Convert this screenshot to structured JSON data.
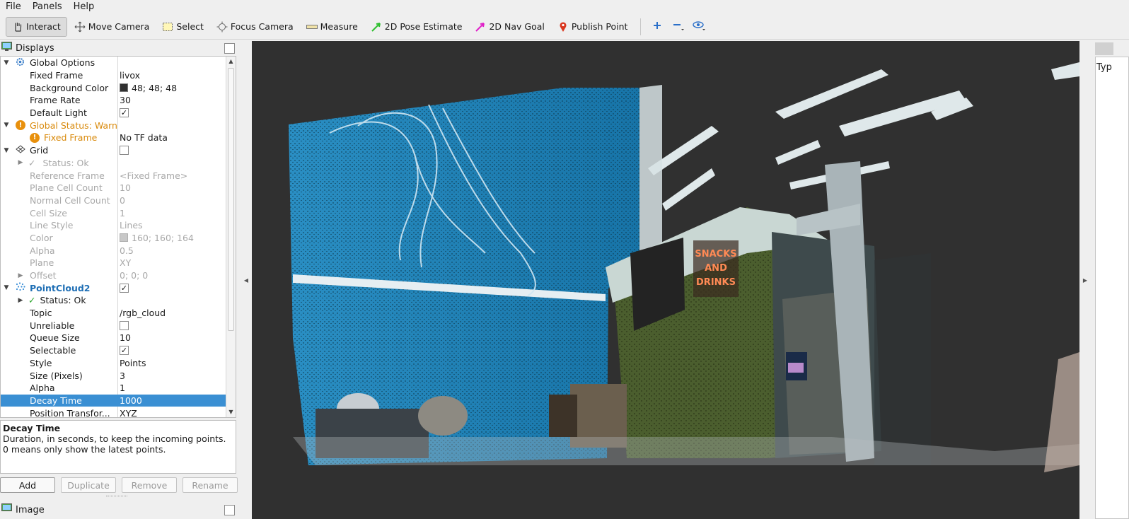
{
  "menu": [
    "File",
    "Panels",
    "Help"
  ],
  "toolbar": {
    "tools": [
      {
        "label": "Interact",
        "icon": "hand-icon"
      },
      {
        "label": "Move Camera",
        "icon": "move-camera-icon"
      },
      {
        "label": "Select",
        "icon": "select-icon"
      },
      {
        "label": "Focus Camera",
        "icon": "focus-camera-icon"
      },
      {
        "label": "Measure",
        "icon": "ruler-icon"
      },
      {
        "label": "2D Pose Estimate",
        "icon": "green-arrow-icon"
      },
      {
        "label": "2D Nav Goal",
        "icon": "magenta-arrow-icon"
      },
      {
        "label": "Publish Point",
        "icon": "map-pin-icon"
      }
    ]
  },
  "displays": {
    "title": "Displays",
    "global_options": "Global Options",
    "fixed_frame_label": "Fixed Frame",
    "fixed_frame_value": "livox",
    "background_color_label": "Background Color",
    "background_color_value": "48; 48; 48",
    "frame_rate_label": "Frame Rate",
    "frame_rate_value": "30",
    "default_light_label": "Default Light",
    "global_status": "Global Status: Warn",
    "fixed_frame_warn_label": "Fixed Frame",
    "fixed_frame_warn_value": "No TF data",
    "grid": "Grid",
    "status_ok": "Status: Ok",
    "reference_frame_label": "Reference Frame",
    "reference_frame_value": "<Fixed Frame>",
    "plane_cell_count_label": "Plane Cell Count",
    "plane_cell_count_value": "10",
    "normal_cell_count_label": "Normal Cell Count",
    "normal_cell_count_value": "0",
    "cell_size_label": "Cell Size",
    "cell_size_value": "1",
    "line_style_label": "Line Style",
    "line_style_value": "Lines",
    "color_label": "Color",
    "color_value": "160; 160; 164",
    "alpha_label": "Alpha",
    "alpha_value": "0.5",
    "plane_label": "Plane",
    "plane_value": "XY",
    "offset_label": "Offset",
    "offset_value": "0; 0; 0",
    "pointcloud": "PointCloud2",
    "pc_status": "Status: Ok",
    "topic_label": "Topic",
    "topic_value": "/rgb_cloud",
    "unreliable_label": "Unreliable",
    "queue_size_label": "Queue Size",
    "queue_size_value": "10",
    "selectable_label": "Selectable",
    "style_label": "Style",
    "style_value": "Points",
    "size_label": "Size (Pixels)",
    "size_value": "3",
    "pc_alpha_label": "Alpha",
    "pc_alpha_value": "1",
    "decay_label": "Decay Time",
    "decay_value": "1000",
    "position_label": "Position Transfor...",
    "position_value": "XYZ"
  },
  "description": {
    "title": "Decay Time",
    "text": "Duration, in seconds, to keep the incoming points. 0 means only show the latest points."
  },
  "buttons": {
    "add": "Add",
    "duplicate": "Duplicate",
    "remove": "Remove",
    "rename": "Rename"
  },
  "image_panel": "Image",
  "right_panel": {
    "label": "Typ"
  },
  "scene_text": {
    "sign_line1": "SNACKS",
    "sign_line2": "AND",
    "sign_line3": "DRINKS"
  },
  "colors": {
    "viewport_bg": "#303030",
    "selection": "#3a8fd3",
    "wall": "#1f7fae",
    "booth": "#4b5e2e"
  }
}
